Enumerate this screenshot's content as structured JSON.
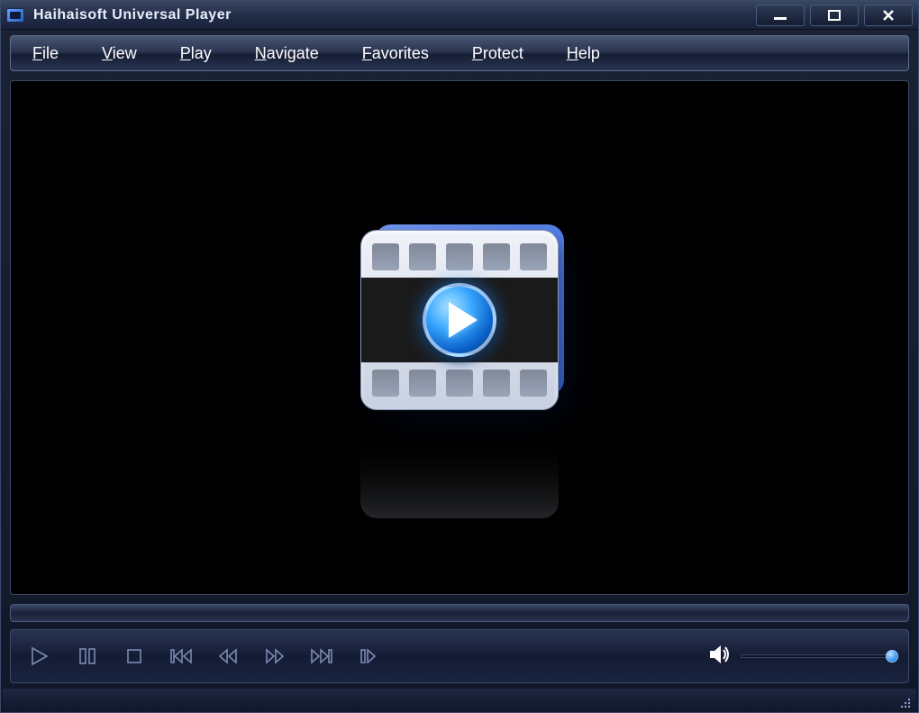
{
  "title": "Haihaisoft Universal Player",
  "menu": {
    "file": "File",
    "view": "View",
    "play": "Play",
    "navigate": "Navigate",
    "favorites": "Favorites",
    "protect": "Protect",
    "help": "Help"
  },
  "controls": {
    "play": "Play",
    "pause": "Pause",
    "stop": "Stop",
    "prev": "Previous",
    "rewind": "Rewind",
    "forward": "Forward",
    "next": "Next",
    "step": "Step Frame"
  },
  "volume": {
    "level": 100
  },
  "icons": {
    "minimize": "minimize",
    "maximize": "maximize",
    "close": "close",
    "speaker": "speaker",
    "resize": "resize-grip"
  }
}
